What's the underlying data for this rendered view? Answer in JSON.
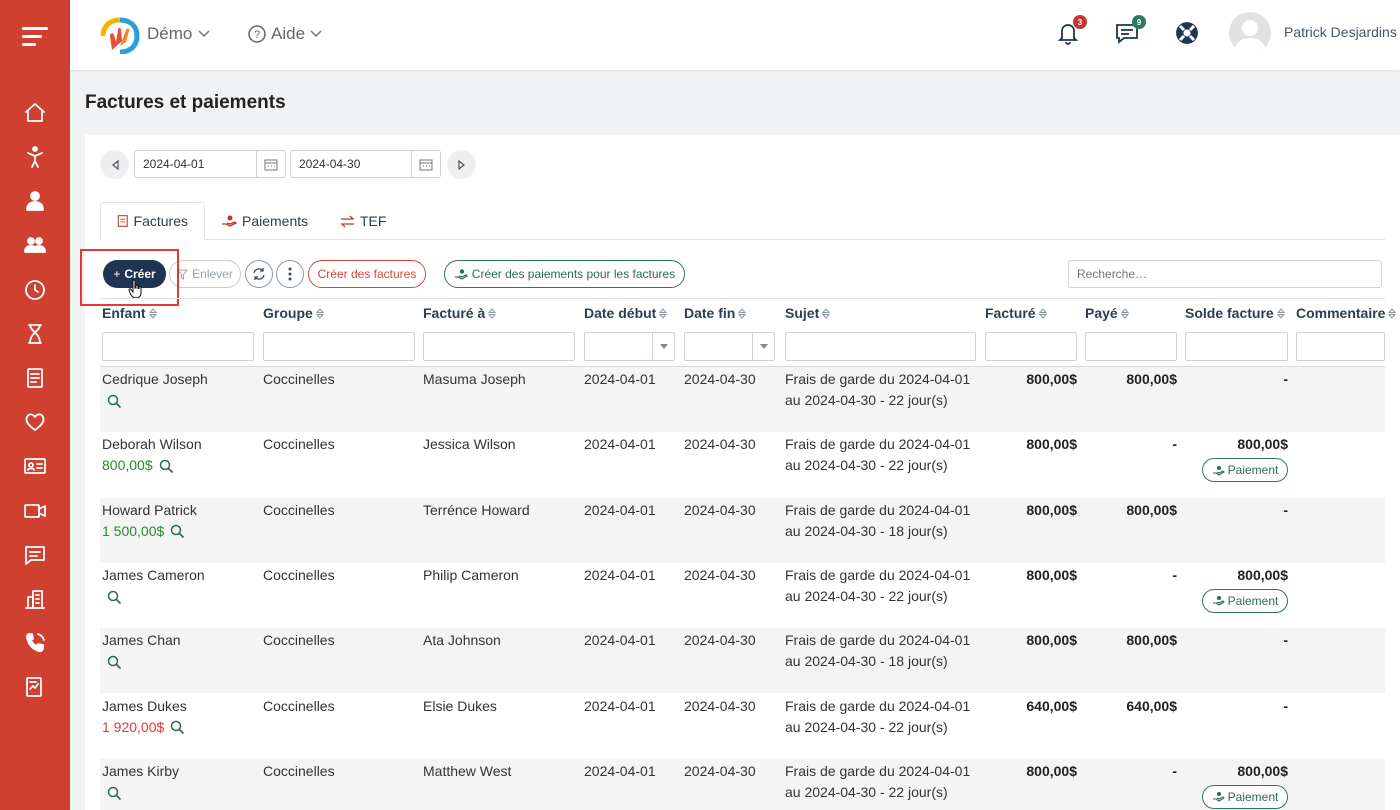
{
  "header": {
    "brand": "Démo",
    "help": "Aide",
    "notifications_count": "3",
    "messages_count": "9",
    "user_name": "Patrick Desjardins"
  },
  "page": {
    "title": "Factures et paiements"
  },
  "date_range": {
    "start": "2024-04-01",
    "end": "2024-04-30"
  },
  "tabs": [
    {
      "label": "Factures",
      "icon": "invoice-icon",
      "active": true
    },
    {
      "label": "Paiements",
      "icon": "payment-hand-icon",
      "active": false
    },
    {
      "label": "TEF",
      "icon": "transfer-icon",
      "active": false
    }
  ],
  "toolbar": {
    "create": "Créer",
    "remove": "Enlever",
    "create_invoices": "Créer des factures",
    "create_payments": "Créer des paiements pour les factures",
    "search_placeholder": "Recherche…"
  },
  "columns": [
    "Enfant",
    "Groupe",
    "Facturé à",
    "Date début",
    "Date fin",
    "Sujet",
    "Facturé",
    "Payé",
    "Solde facture",
    "Commentaire"
  ],
  "rows": [
    {
      "child": "Cedrique Joseph",
      "balance": "",
      "balance_type": "none",
      "group": "Coccinelles",
      "billed_to": "Masuma Joseph",
      "start": "2024-04-01",
      "end": "2024-04-30",
      "subject_1": "Frais de garde du 2024-04-01",
      "subject_2": "au 2024-04-30 - 22 jour(s)",
      "billed": "800,00$",
      "paid": "800,00$",
      "invoice_balance": "-",
      "pay_button": false
    },
    {
      "child": "Deborah Wilson",
      "balance": "800,00$",
      "balance_type": "green",
      "group": "Coccinelles",
      "billed_to": "Jessica Wilson",
      "start": "2024-04-01",
      "end": "2024-04-30",
      "subject_1": "Frais de garde du 2024-04-01",
      "subject_2": "au 2024-04-30 - 22 jour(s)",
      "billed": "800,00$",
      "paid": "-",
      "invoice_balance": "800,00$",
      "pay_button": true
    },
    {
      "child": "Howard Patrick",
      "balance": "1 500,00$",
      "balance_type": "green",
      "group": "Coccinelles",
      "billed_to": "Terrénce Howard",
      "start": "2024-04-01",
      "end": "2024-04-30",
      "subject_1": "Frais de garde du 2024-04-01",
      "subject_2": "au 2024-04-30 - 18 jour(s)",
      "billed": "800,00$",
      "paid": "800,00$",
      "invoice_balance": "-",
      "pay_button": false
    },
    {
      "child": "James Cameron",
      "balance": "",
      "balance_type": "none",
      "group": "Coccinelles",
      "billed_to": "Philip Cameron",
      "start": "2024-04-01",
      "end": "2024-04-30",
      "subject_1": "Frais de garde du 2024-04-01",
      "subject_2": "au 2024-04-30 - 22 jour(s)",
      "billed": "800,00$",
      "paid": "-",
      "invoice_balance": "800,00$",
      "pay_button": true
    },
    {
      "child": "James Chan",
      "balance": "",
      "balance_type": "none",
      "group": "Coccinelles",
      "billed_to": "Ata Johnson",
      "start": "2024-04-01",
      "end": "2024-04-30",
      "subject_1": "Frais de garde du 2024-04-01",
      "subject_2": "au 2024-04-30 - 18 jour(s)",
      "billed": "800,00$",
      "paid": "800,00$",
      "invoice_balance": "-",
      "pay_button": false
    },
    {
      "child": "James Dukes",
      "balance": "1 920,00$",
      "balance_type": "red",
      "group": "Coccinelles",
      "billed_to": "Elsie Dukes",
      "start": "2024-04-01",
      "end": "2024-04-30",
      "subject_1": "Frais de garde du 2024-04-01",
      "subject_2": "au 2024-04-30 - 22 jour(s)",
      "billed": "640,00$",
      "paid": "640,00$",
      "invoice_balance": "-",
      "pay_button": false
    },
    {
      "child": "James Kirby",
      "balance": "",
      "balance_type": "none",
      "group": "Coccinelles",
      "billed_to": "Matthew West",
      "start": "2024-04-01",
      "end": "2024-04-30",
      "subject_1": "Frais de garde du 2024-04-01",
      "subject_2": "au 2024-04-30 - 22 jour(s)",
      "billed": "800,00$",
      "paid": "-",
      "invoice_balance": "800,00$",
      "pay_button": true
    }
  ],
  "pay_label": "Paiement",
  "colors": {
    "sidebar": "#cf4030",
    "primary": "#1f3452",
    "green": "#2a8a2a",
    "red": "#e53935"
  }
}
